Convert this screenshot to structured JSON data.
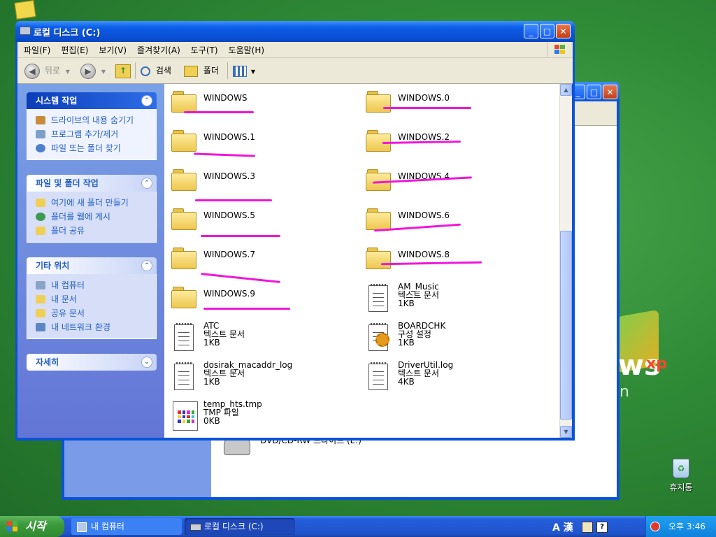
{
  "window": {
    "title": "로컬 디스크 (C:)",
    "menu": [
      "파일(F)",
      "편집(E)",
      "보기(V)",
      "즐겨찾기(A)",
      "도구(T)",
      "도움말(H)"
    ],
    "toolbar": {
      "back": "뒤로",
      "search": "검색",
      "folders": "폴더"
    }
  },
  "leftpane": {
    "panels": [
      {
        "title": "시스템 작업",
        "items": [
          "드라이브의 내용 숨기기",
          "프로그램 추가/제거",
          "파일 또는 폴더 찾기"
        ]
      },
      {
        "title": "파일 및 폴더 작업",
        "items": [
          "여기에 새 폴더 만들기",
          "폴더를 웹에 게시",
          "폴더 공유"
        ]
      },
      {
        "title": "기타 위치",
        "items": [
          "내 컴퓨터",
          "내 문서",
          "공유 문서",
          "내 네트워크 환경"
        ]
      },
      {
        "title": "자세히",
        "items": []
      }
    ]
  },
  "files": [
    {
      "name": "WINDOWS",
      "kind": "folder"
    },
    {
      "name": "WINDOWS.0",
      "kind": "folder"
    },
    {
      "name": "WINDOWS.1",
      "kind": "folder"
    },
    {
      "name": "WINDOWS.2",
      "kind": "folder"
    },
    {
      "name": "WINDOWS.3",
      "kind": "folder"
    },
    {
      "name": "WINDOWS.4",
      "kind": "folder"
    },
    {
      "name": "WINDOWS.5",
      "kind": "folder"
    },
    {
      "name": "WINDOWS.6",
      "kind": "folder"
    },
    {
      "name": "WINDOWS.7",
      "kind": "folder"
    },
    {
      "name": "WINDOWS.8",
      "kind": "folder"
    },
    {
      "name": "WINDOWS.9",
      "kind": "folder"
    },
    {
      "name": "AM_Music",
      "kind": "text",
      "type": "텍스트 문서",
      "size": "1KB"
    },
    {
      "name": "ATC",
      "kind": "text",
      "type": "텍스트 문서",
      "size": "1KB"
    },
    {
      "name": "BOARDCHK",
      "kind": "config",
      "type": "구성 설정",
      "size": "1KB"
    },
    {
      "name": "dosirak_macaddr_log",
      "kind": "text",
      "type": "텍스트 문서",
      "size": "1KB"
    },
    {
      "name": "DriverUtil.log",
      "kind": "text",
      "type": "텍스트 문서",
      "size": "4KB"
    },
    {
      "name": "temp_hts.tmp",
      "kind": "tmp",
      "type": "TMP 파일",
      "size": "0KB"
    }
  ],
  "background_window": {
    "partial_item": "DVD/CD-RW 드라이브 (E:)"
  },
  "desktop": {
    "recycle_bin": "휴지통",
    "xp_logo": "xp",
    "xp_fragment_1": "ws",
    "xp_fragment_2": "n"
  },
  "taskbar": {
    "start": "시작",
    "tasks": [
      "내 컴퓨터",
      "로컬 디스크 (C:)"
    ],
    "ime": "A 漢",
    "clock": "오후 3:46"
  },
  "colors": {
    "annotation": "#ee17d9",
    "xp_blue": "#0a53d8",
    "link_blue": "#215dc6"
  }
}
